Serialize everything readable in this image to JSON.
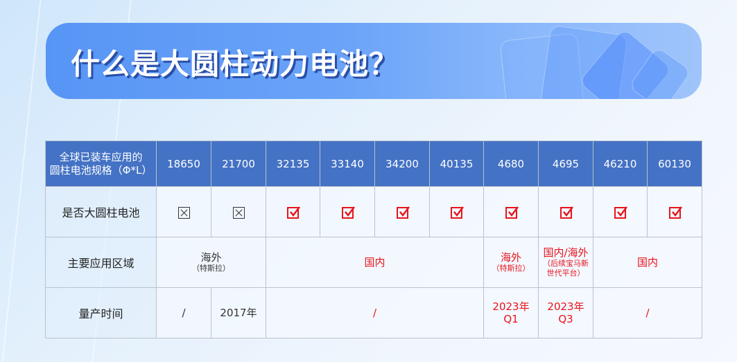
{
  "title": "什么是大圆柱动力电池？",
  "colors": {
    "header_bg": "#4472c4",
    "accent_red": "#e8141c",
    "banner_start": "#5795f5",
    "banner_end": "#9fc4fb"
  },
  "table": {
    "corner_header": [
      "全球已装车应用的",
      "圆柱电池规格（Φ*L）"
    ],
    "columns": [
      "18650",
      "21700",
      "32135",
      "33140",
      "34200",
      "40135",
      "4680",
      "4695",
      "46210",
      "60130"
    ],
    "rows": {
      "is_large_cylinder": {
        "label": "是否大圆柱电池",
        "values": [
          "no",
          "no",
          "yes",
          "yes",
          "yes",
          "yes",
          "yes",
          "yes",
          "yes",
          "yes"
        ],
        "icons": {
          "no": "checkbox-crossed-icon",
          "yes": "checkbox-checked-icon"
        }
      },
      "application_region": {
        "label": "主要应用区域",
        "cells": [
          {
            "span": "18650-21700",
            "main": "海外",
            "sub": "（特斯拉）",
            "color": "dark"
          },
          {
            "span": "32135-40135",
            "main": "国内",
            "sub": "",
            "color": "red"
          },
          {
            "span": "4680",
            "main": "海外",
            "sub": "（特斯拉）",
            "color": "red"
          },
          {
            "span": "4695",
            "main": "国内/海外",
            "sub": "（后续宝马新世代平台）",
            "color": "red"
          },
          {
            "span": "46210-60130",
            "main": "国内",
            "sub": "",
            "color": "red"
          }
        ]
      },
      "mass_production": {
        "label": "量产时间",
        "cells": [
          {
            "span": "18650",
            "main": "/",
            "color": "dark"
          },
          {
            "span": "21700",
            "main": "2017年",
            "color": "dark"
          },
          {
            "span": "32135-40135",
            "main": "/",
            "color": "red"
          },
          {
            "span": "4680",
            "main": "2023年",
            "sub": "Q1",
            "color": "red"
          },
          {
            "span": "4695",
            "main": "2023年",
            "sub": "Q3",
            "color": "red"
          },
          {
            "span": "46210-60130",
            "main": "/",
            "color": "red"
          }
        ]
      }
    }
  }
}
